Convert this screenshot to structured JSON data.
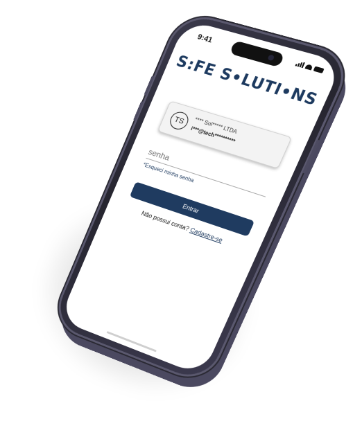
{
  "status_bar": {
    "time": "9:41"
  },
  "brand": {
    "logo_text": "S:FE S•LUTI•NS",
    "color": "#1d3a5f"
  },
  "account": {
    "initials": "TS",
    "company": "**** Sol***** LTDA",
    "email": "i***@tech**********"
  },
  "login": {
    "password_placeholder": "senha",
    "forgot_label": "*Esqueci minha senha",
    "enter_label": "Entrar",
    "no_account_text": "Não possui conta?",
    "signup_link": "Cadastre-se"
  },
  "colors": {
    "primary_button": "#1f3b60",
    "phone_frame": "#3b3a4c"
  }
}
